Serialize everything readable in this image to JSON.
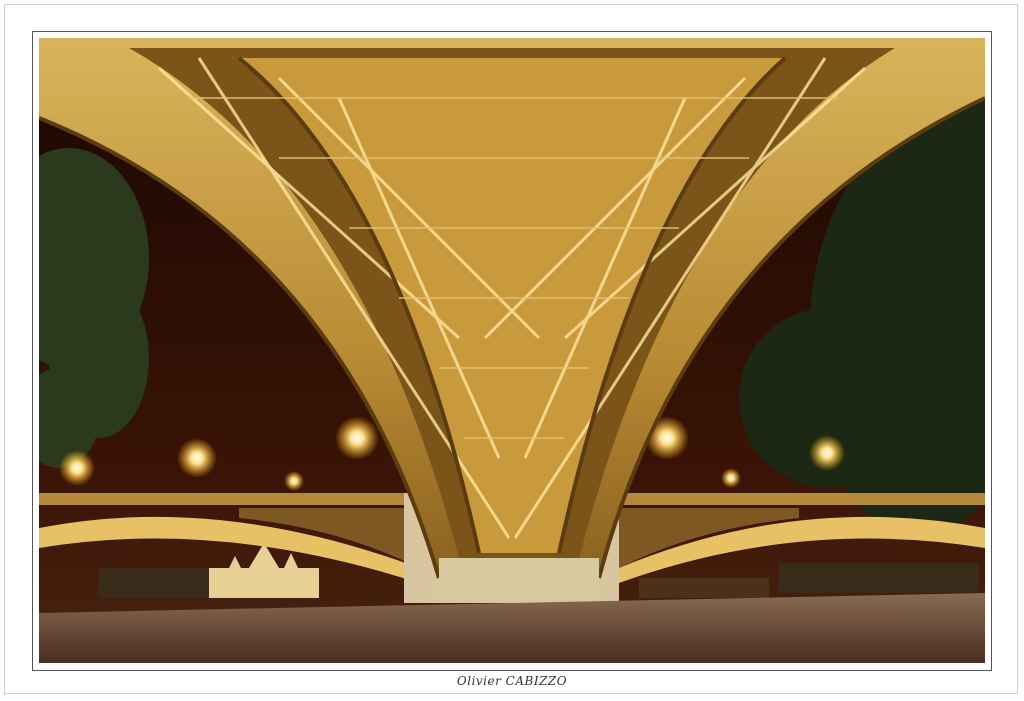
{
  "signature": "Olivier CABIZZO",
  "palette": {
    "sky": "#2a0d05",
    "steel": "#c9a548",
    "steel_dark": "#6e4d12",
    "light": "#ffe08a",
    "ground": "#5a4030",
    "foliage": "#1f2a15"
  }
}
